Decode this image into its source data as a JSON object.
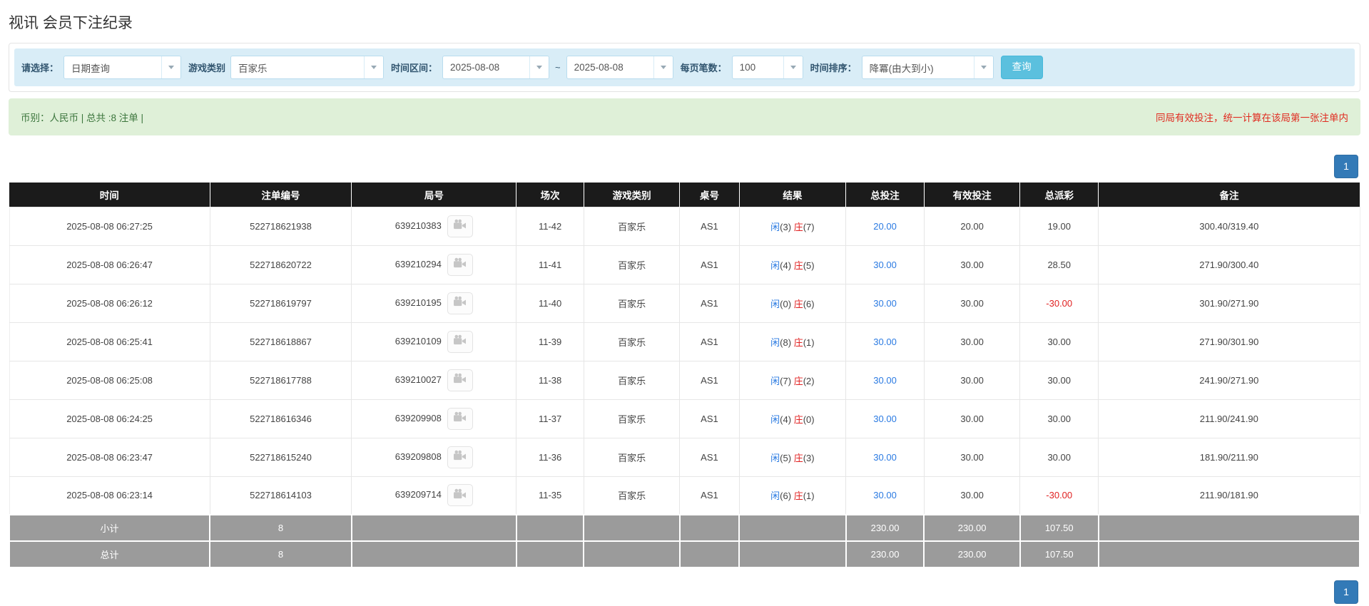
{
  "page": {
    "title": "视讯 会员下注纪录"
  },
  "filters": {
    "please_select_label": "请选择：",
    "please_select_value": "日期查询",
    "game_type_label": "游戏类别",
    "game_type_value": "百家乐",
    "time_range_label": "时间区间：",
    "date_from": "2025-08-08",
    "tilde": "~",
    "date_to": "2025-08-08",
    "page_size_label": "每页笔数：",
    "page_size_value": "100",
    "time_sort_label": "时间排序：",
    "time_sort_value": "降冪(由大到小)",
    "search_label": "查询"
  },
  "summary": {
    "left": "币别：人民币 | 总共 :8 注单 |",
    "right": "同局有效投注，统一计算在该局第一张注单内"
  },
  "pagination": {
    "page": "1"
  },
  "colors": {
    "accent": "#5bc0de",
    "link": "#2a7ae2",
    "player": "#2a7ae2",
    "banker": "#e02020",
    "negative": "#e02020"
  },
  "table": {
    "columns": [
      "时间",
      "注单编号",
      "局号",
      "场次",
      "游戏类别",
      "桌号",
      "结果",
      "总投注",
      "有效投注",
      "总派彩",
      "备注"
    ],
    "rows": [
      {
        "time": "2025-08-08 06:27:25",
        "bet_id": "522718621938",
        "round_id": "639210383",
        "session": "11-42",
        "game": "百家乐",
        "table_no": "AS1",
        "result": {
          "p": "闲",
          "pn": "(3)",
          "b": "庄",
          "bn": "(7)"
        },
        "total_bet": "20.00",
        "valid_bet": "20.00",
        "payout": "19.00",
        "remark": "300.40/319.40"
      },
      {
        "time": "2025-08-08 06:26:47",
        "bet_id": "522718620722",
        "round_id": "639210294",
        "session": "11-41",
        "game": "百家乐",
        "table_no": "AS1",
        "result": {
          "p": "闲",
          "pn": "(4)",
          "b": "庄",
          "bn": "(5)"
        },
        "total_bet": "30.00",
        "valid_bet": "30.00",
        "payout": "28.50",
        "remark": "271.90/300.40"
      },
      {
        "time": "2025-08-08 06:26:12",
        "bet_id": "522718619797",
        "round_id": "639210195",
        "session": "11-40",
        "game": "百家乐",
        "table_no": "AS1",
        "result": {
          "p": "闲",
          "pn": "(0)",
          "b": "庄",
          "bn": "(6)"
        },
        "total_bet": "30.00",
        "valid_bet": "30.00",
        "payout": "-30.00",
        "remark": "301.90/271.90"
      },
      {
        "time": "2025-08-08 06:25:41",
        "bet_id": "522718618867",
        "round_id": "639210109",
        "session": "11-39",
        "game": "百家乐",
        "table_no": "AS1",
        "result": {
          "p": "闲",
          "pn": "(8)",
          "b": "庄",
          "bn": "(1)"
        },
        "total_bet": "30.00",
        "valid_bet": "30.00",
        "payout": "30.00",
        "remark": "271.90/301.90"
      },
      {
        "time": "2025-08-08 06:25:08",
        "bet_id": "522718617788",
        "round_id": "639210027",
        "session": "11-38",
        "game": "百家乐",
        "table_no": "AS1",
        "result": {
          "p": "闲",
          "pn": "(7)",
          "b": "庄",
          "bn": "(2)"
        },
        "total_bet": "30.00",
        "valid_bet": "30.00",
        "payout": "30.00",
        "remark": "241.90/271.90"
      },
      {
        "time": "2025-08-08 06:24:25",
        "bet_id": "522718616346",
        "round_id": "639209908",
        "session": "11-37",
        "game": "百家乐",
        "table_no": "AS1",
        "result": {
          "p": "闲",
          "pn": "(4)",
          "b": "庄",
          "bn": "(0)"
        },
        "total_bet": "30.00",
        "valid_bet": "30.00",
        "payout": "30.00",
        "remark": "211.90/241.90"
      },
      {
        "time": "2025-08-08 06:23:47",
        "bet_id": "522718615240",
        "round_id": "639209808",
        "session": "11-36",
        "game": "百家乐",
        "table_no": "AS1",
        "result": {
          "p": "闲",
          "pn": "(5)",
          "b": "庄",
          "bn": "(3)"
        },
        "total_bet": "30.00",
        "valid_bet": "30.00",
        "payout": "30.00",
        "remark": "181.90/211.90"
      },
      {
        "time": "2025-08-08 06:23:14",
        "bet_id": "522718614103",
        "round_id": "639209714",
        "session": "11-35",
        "game": "百家乐",
        "table_no": "AS1",
        "result": {
          "p": "闲",
          "pn": "(6)",
          "b": "庄",
          "bn": "(1)"
        },
        "total_bet": "30.00",
        "valid_bet": "30.00",
        "payout": "-30.00",
        "remark": "211.90/181.90"
      }
    ],
    "footer": [
      {
        "label": "小计",
        "count": "8",
        "total_bet": "230.00",
        "valid_bet": "230.00",
        "payout": "107.50"
      },
      {
        "label": "总计",
        "count": "8",
        "total_bet": "230.00",
        "valid_bet": "230.00",
        "payout": "107.50"
      }
    ]
  }
}
